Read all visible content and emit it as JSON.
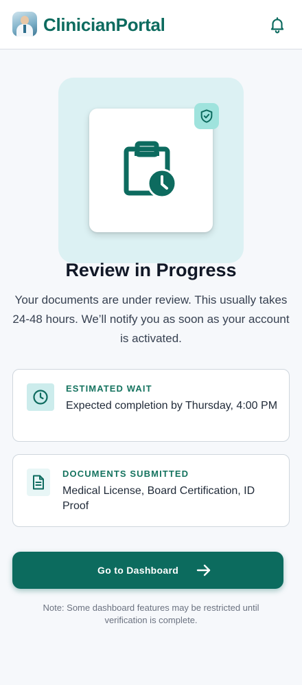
{
  "header": {
    "brand": "ClinicianPortal",
    "logo_icon": "doctor-avatar-icon",
    "notification_icon": "bell-icon"
  },
  "hero": {
    "main_icon": "clipboard-clock-icon",
    "badge_icon": "shield-check-icon",
    "title": "Review in Progress",
    "subtitle": "Your documents are under review. This usually takes 24-48 hours. We’ll notify you as soon as your account is activated."
  },
  "cards": [
    {
      "icon": "clock-icon",
      "label": "ESTIMATED WAIT",
      "text": "Expected completion by Thursday, 4:00 PM"
    },
    {
      "icon": "document-icon",
      "label": "DOCUMENTS SUBMITTED",
      "text": "Medical License, Board Certification, ID Proof"
    }
  ],
  "cta": {
    "label": "Go to Dashboard",
    "icon": "arrow-right-icon"
  },
  "note": "Note: Some dashboard features may be restricted until verification is complete.",
  "colors": {
    "brand": "#0d6b5f",
    "hero_bg": "#dcf1f3",
    "badge": "#9fe3dd",
    "accent_label": "#15735f",
    "page_bg": "#f6f8fb"
  }
}
